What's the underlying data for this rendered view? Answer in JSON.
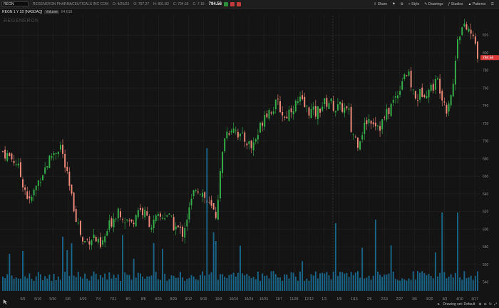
{
  "toolbar": {
    "symbol": "REGN",
    "company": "REGENERON PHARMACEUTICALS INC COM",
    "date": "D: 4/25/23",
    "open": "O: 797.27",
    "high": "H: 801.82",
    "close": "C: 794.56",
    "change": "C: 7.18",
    "last_price": "794.56",
    "buttons": [
      "Share",
      "Style",
      "Drawings",
      "Studies",
      "Patterns"
    ],
    "flag_colors": [
      "#2d8f3a",
      "#c23b3b",
      "#c23b3b"
    ]
  },
  "subheader": {
    "title": "REGN 1 Y 1D [NASDAQ]",
    "volume_label": "Volume",
    "volume_value": "64,618"
  },
  "watermark": "REGENERON",
  "price_badge": "794.56",
  "drawing_set": "Drawing set: Default",
  "colors": {
    "up": "#35b04a",
    "down": "#f08a7a",
    "volume": "#1b6e94",
    "badge": "#d93b3b",
    "bg": "#141414",
    "grid": "#262626"
  },
  "chart_data": {
    "type": "candlestick",
    "x": [
      "5/9",
      "5/16",
      "5/30",
      "6/6",
      "6/20",
      "7/4",
      "7/11",
      "8/1",
      "8/8",
      "8/15",
      "8/29",
      "9/12",
      "9/19",
      "10/3",
      "10/10",
      "10/24",
      "10/31",
      "11/7",
      "11/28",
      "12/12",
      "1/3",
      "1/9",
      "1/16",
      "2/6",
      "2/13",
      "2/27",
      "3/6",
      "3/20",
      "4/3",
      "4/10",
      "4/17"
    ],
    "y_ticks": [
      520,
      540,
      560,
      580,
      600,
      620,
      640,
      660,
      680,
      700,
      720,
      740,
      760,
      780,
      800,
      820
    ],
    "ylim": [
      530,
      842
    ],
    "close_path": [
      [
        0,
        688
      ],
      [
        6,
        676
      ],
      [
        12,
        630
      ],
      [
        17,
        660
      ],
      [
        22,
        684
      ],
      [
        26,
        695
      ],
      [
        31,
        635
      ],
      [
        36,
        585
      ],
      [
        41,
        592
      ],
      [
        44,
        578
      ],
      [
        48,
        604
      ],
      [
        52,
        623
      ],
      [
        55,
        612
      ],
      [
        58,
        606
      ],
      [
        61,
        624
      ],
      [
        64,
        617
      ],
      [
        67,
        604
      ],
      [
        70,
        612
      ],
      [
        74,
        617
      ],
      [
        77,
        604
      ],
      [
        81,
        596
      ],
      [
        84,
        622
      ],
      [
        87,
        649
      ],
      [
        90,
        641
      ],
      [
        92,
        630
      ],
      [
        96,
        616
      ],
      [
        100,
        707
      ],
      [
        104,
        718
      ],
      [
        107,
        704
      ],
      [
        110,
        700
      ],
      [
        112,
        693
      ],
      [
        115,
        708
      ],
      [
        118,
        732
      ],
      [
        121,
        736
      ],
      [
        124,
        742
      ],
      [
        127,
        726
      ],
      [
        130,
        738
      ],
      [
        134,
        745
      ],
      [
        137,
        736
      ],
      [
        141,
        731
      ],
      [
        144,
        741
      ],
      [
        147,
        745
      ],
      [
        150,
        737
      ],
      [
        153,
        738
      ],
      [
        156,
        731
      ],
      [
        157,
        712
      ],
      [
        160,
        699
      ],
      [
        164,
        723
      ],
      [
        166,
        725
      ],
      [
        170,
        717
      ],
      [
        174,
        735
      ],
      [
        178,
        755
      ],
      [
        181,
        778
      ],
      [
        183,
        772
      ],
      [
        186,
        747
      ],
      [
        189,
        756
      ],
      [
        192,
        758
      ],
      [
        196,
        768
      ],
      [
        200,
        737
      ],
      [
        203,
        763
      ],
      [
        205,
        820
      ],
      [
        207,
        828
      ],
      [
        210,
        826
      ],
      [
        213,
        810
      ],
      [
        214,
        798
      ]
    ],
    "n_days": 214,
    "volume_avg": 1.0
  }
}
